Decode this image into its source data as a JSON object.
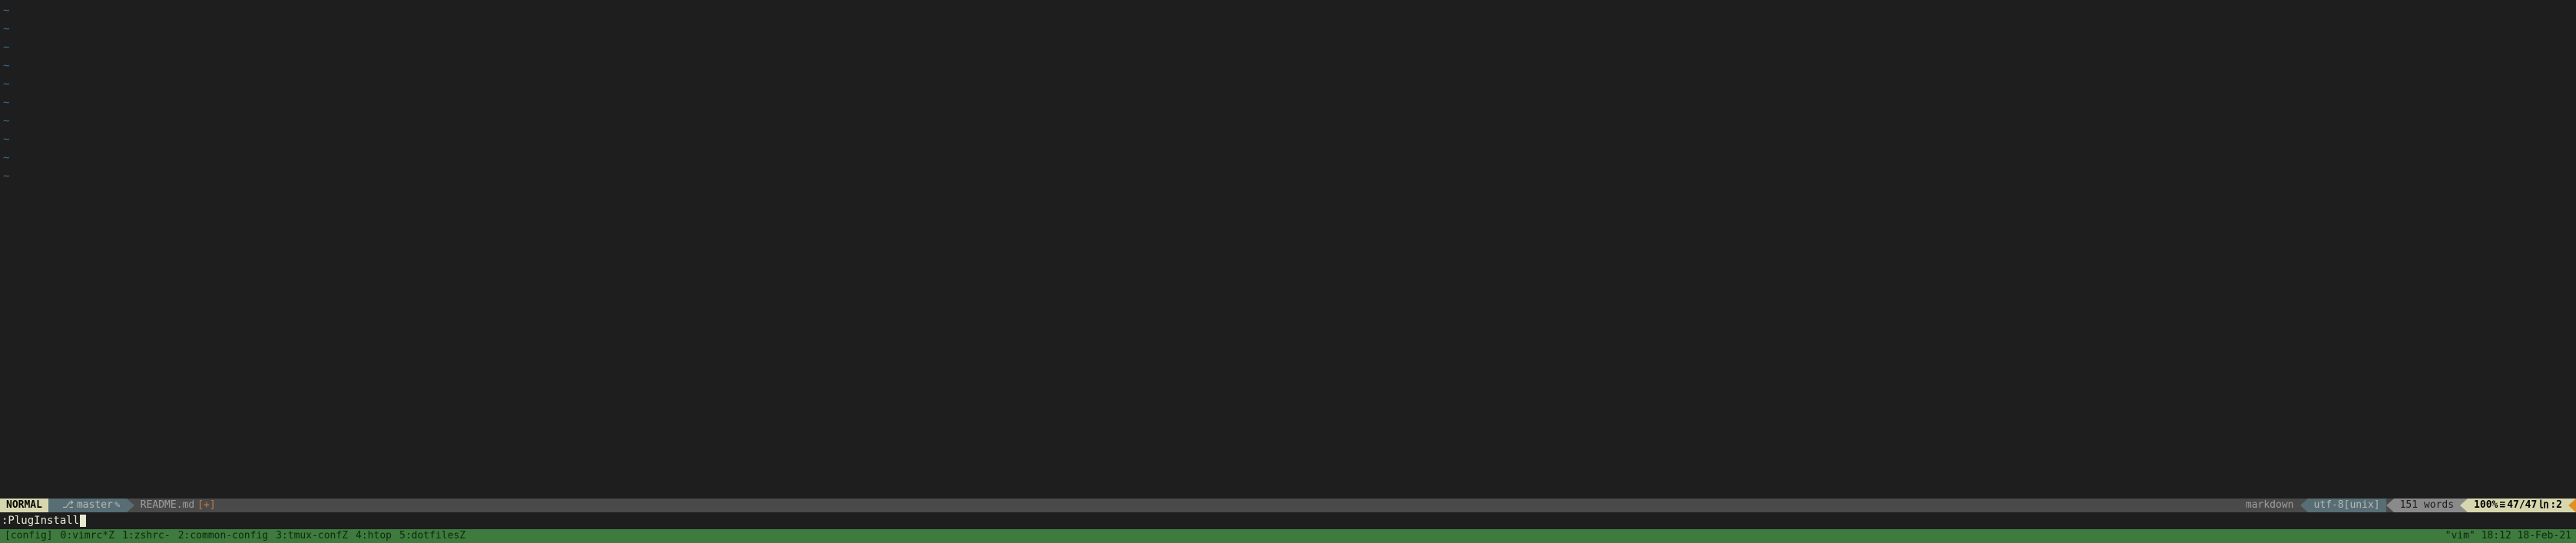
{
  "editor": {
    "tilde": "~",
    "empty_line_count": 10
  },
  "statusline": {
    "mode": "NORMAL",
    "branch_icon": "⎇",
    "branch": "master",
    "branch_dirty_icon": "✎",
    "file": "README.md",
    "modified": "[+]",
    "filetype": "markdown",
    "encoding": "utf-8[unix]",
    "words": "151 words",
    "percent": "100%",
    "line_icon": "≡",
    "lines": "47/47",
    "col_icon": "㏑",
    "col": ":2"
  },
  "cmdline": {
    "text": ":PlugInstall"
  },
  "tmux": {
    "session": "[config]",
    "windows": [
      "0:vimrc*Z",
      "1:zshrc-",
      "2:common-config",
      "3:tmux-confZ",
      "4:htop",
      "5:dotfilesZ"
    ],
    "right": "\"vim\" 18:12 18-Feb-21"
  }
}
